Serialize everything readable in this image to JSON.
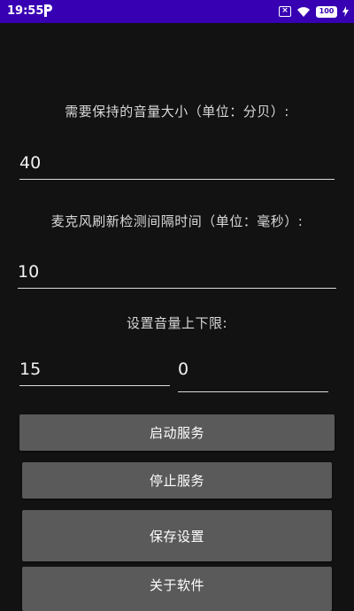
{
  "status_bar": {
    "time": "19:55",
    "app_icon": "p-icon",
    "notification_icon": "close-box-icon",
    "wifi_icon": "wifi-icon",
    "battery_level": "100",
    "charging_icon": "charging-bolt-icon"
  },
  "form": {
    "volume_label": "需要保持的音量大小（单位：分贝）:",
    "volume_value": "40",
    "interval_label": "麦克风刷新检测间隔时间（单位：毫秒）:",
    "interval_value": "10",
    "limits_label": "设置音量上下限:",
    "limit_upper_value": "15",
    "limit_lower_value": "0"
  },
  "buttons": {
    "start": "启动服务",
    "stop": "停止服务",
    "save": "保存设置",
    "close": "关于软件"
  },
  "colors": {
    "status_bar": "#3700b3",
    "background": "#121212",
    "button": "#5a5a5a"
  }
}
